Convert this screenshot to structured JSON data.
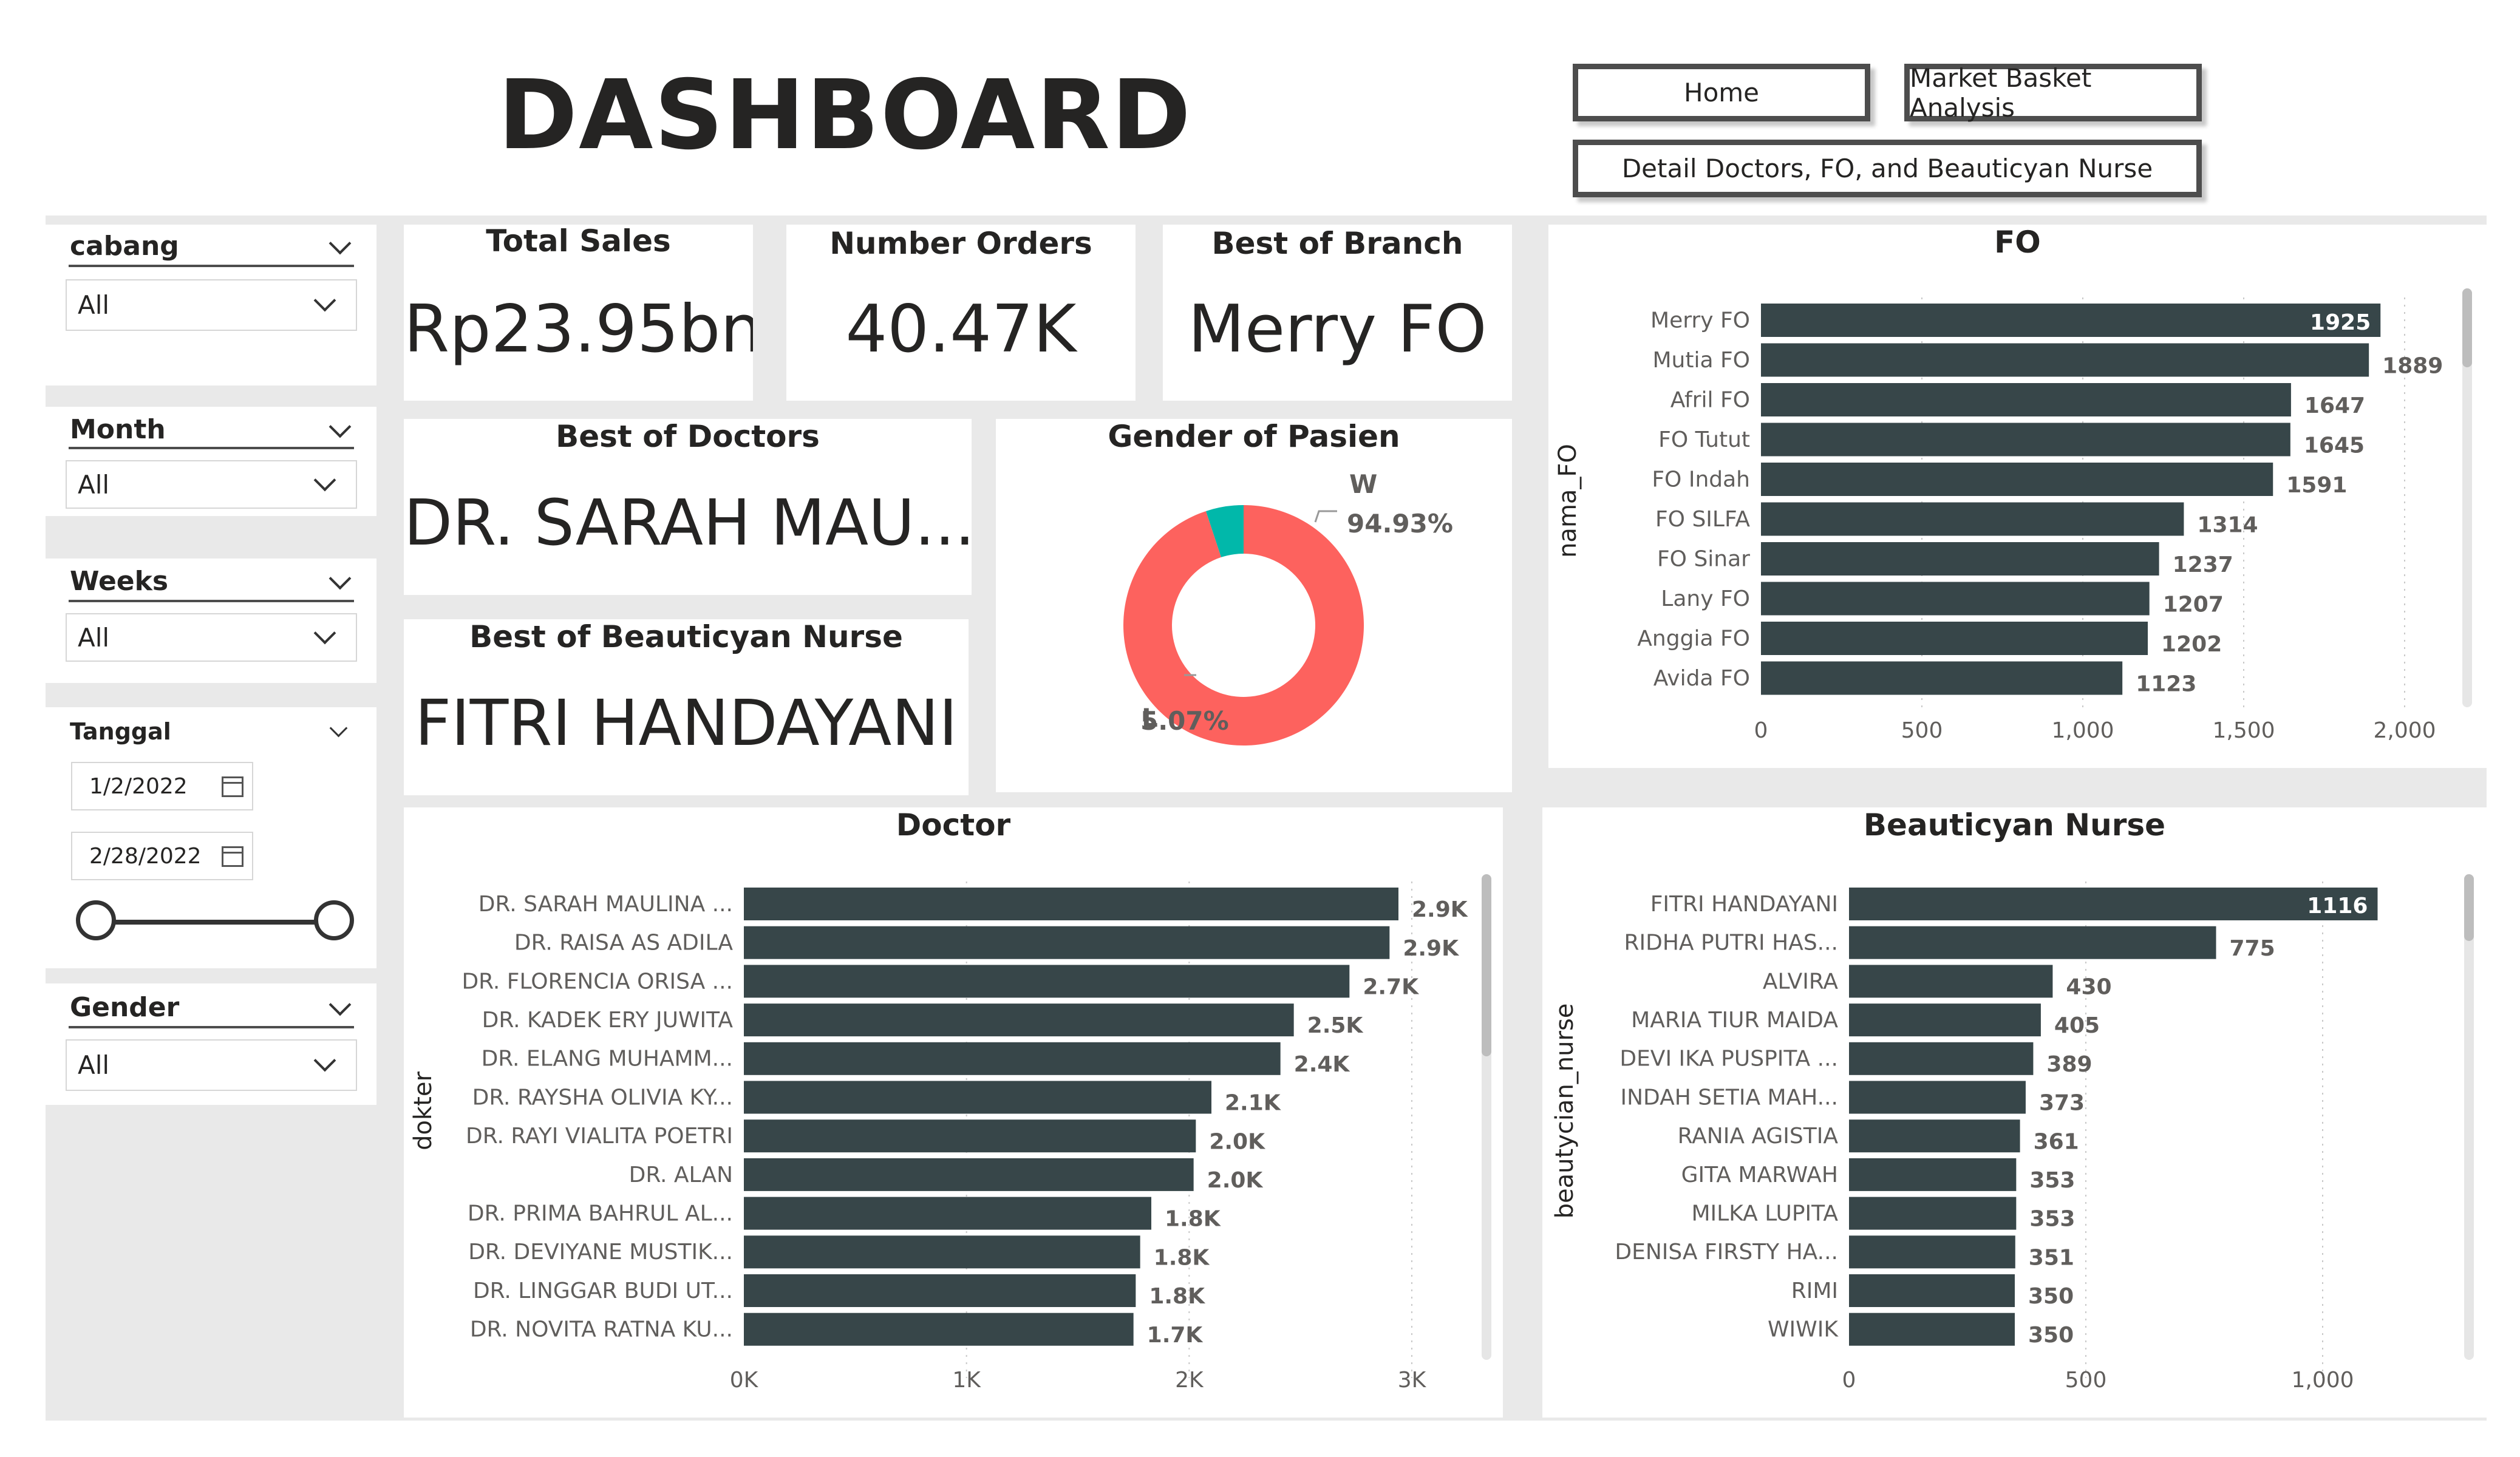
{
  "header": {
    "title": "DASHBOARD",
    "nav": {
      "home": "Home",
      "market_basket": "Market Basket Analysis",
      "detail": "Detail Doctors, FO, and Beauticyan Nurse"
    }
  },
  "filters": {
    "cabang": {
      "label": "cabang",
      "value": "All"
    },
    "month": {
      "label": "Month",
      "value": "All"
    },
    "weeks": {
      "label": "Weeks",
      "value": "All"
    },
    "tanggal": {
      "label": "Tanggal",
      "start": "1/2/2022",
      "end": "2/28/2022"
    },
    "gender": {
      "label": "Gender",
      "value": "All"
    }
  },
  "cards": {
    "total_sales": {
      "title": "Total Sales",
      "value": "Rp23.95bn"
    },
    "number_orders": {
      "title": "Number Orders",
      "value": "40.47K"
    },
    "best_branch": {
      "title": "Best of Branch",
      "value": "Merry FO"
    },
    "best_doctors": {
      "title": "Best of Doctors",
      "value": "DR. SARAH MAU..."
    },
    "best_nurse": {
      "title": "Best of Beauticyan Nurse",
      "value": "FITRI HANDAYANI"
    }
  },
  "colors": {
    "bar": "#374649",
    "donut_w": "#fd625e",
    "donut_l": "#01b8aa",
    "panel_bg": "#e9e9e9"
  },
  "chart_data": [
    {
      "id": "gender",
      "type": "pie",
      "title": "Gender of Pasien",
      "slices": [
        {
          "label": "W",
          "value": 94.93,
          "value_label": "94.93%"
        },
        {
          "label": "L",
          "value": 5.07,
          "value_label": "5.07%"
        }
      ]
    },
    {
      "id": "fo",
      "type": "bar",
      "orientation": "horizontal",
      "title": "FO",
      "ylabel": "nama_FO",
      "categories": [
        "Merry FO",
        "Mutia FO",
        "Afril FO",
        "FO Tutut",
        "FO Indah",
        "FO SILFA",
        "FO Sinar",
        "Lany FO",
        "Anggia FO",
        "Avida FO"
      ],
      "values": [
        1925,
        1889,
        1647,
        1645,
        1591,
        1314,
        1237,
        1207,
        1202,
        1123
      ],
      "data_labels": [
        "1925",
        "1889",
        "1647",
        "1645",
        "1591",
        "1314",
        "1237",
        "1207",
        "1202",
        "1123"
      ],
      "xlim": [
        0,
        2000
      ],
      "ticks": [
        0,
        500,
        1000,
        1500,
        2000
      ],
      "tick_labels": [
        "0",
        "500",
        "1,000",
        "1,500",
        "2,000"
      ]
    },
    {
      "id": "doctor",
      "type": "bar",
      "orientation": "horizontal",
      "title": "Doctor",
      "ylabel": "dokter",
      "categories": [
        "DR. SARAH MAULINA ...",
        "DR. RAISA AS ADILA",
        "DR. FLORENCIA ORISA ...",
        "DR. KADEK ERY JUWITA",
        "DR. ELANG MUHAMM...",
        "DR. RAYSHA OLIVIA KY...",
        "DR. RAYI VIALITA POETRI",
        "DR. ALAN",
        "DR. PRIMA BAHRUL AL...",
        "DR. DEVIYANE MUSTIK...",
        "DR. LINGGAR BUDI UT...",
        "DR. NOVITA RATNA KU..."
      ],
      "values": [
        2940,
        2900,
        2720,
        2470,
        2410,
        2100,
        2030,
        2020,
        1830,
        1780,
        1760,
        1750
      ],
      "data_labels": [
        "2.9K",
        "2.9K",
        "2.7K",
        "2.5K",
        "2.4K",
        "2.1K",
        "2.0K",
        "2.0K",
        "1.8K",
        "1.8K",
        "1.8K",
        "1.7K"
      ],
      "xlim": [
        0,
        3000
      ],
      "ticks": [
        0,
        1000,
        2000,
        3000
      ],
      "tick_labels": [
        "0K",
        "1K",
        "2K",
        "3K"
      ]
    },
    {
      "id": "nurse",
      "type": "bar",
      "orientation": "horizontal",
      "title": "Beauticyan Nurse",
      "ylabel": "beautycian_nurse",
      "categories": [
        "FITRI HANDAYANI",
        "RIDHA PUTRI HAS...",
        "ALVIRA",
        "MARIA TIUR MAIDA",
        "DEVI IKA PUSPITA ...",
        "INDAH SETIA MAH...",
        "RANIA AGISTIA",
        "GITA MARWAH",
        "MILKA LUPITA",
        "DENISA FIRSTY HA...",
        "RIMI",
        "WIWIK"
      ],
      "values": [
        1116,
        775,
        430,
        405,
        389,
        373,
        361,
        353,
        353,
        351,
        350,
        350
      ],
      "data_labels": [
        "1116",
        "775",
        "430",
        "405",
        "389",
        "373",
        "361",
        "353",
        "353",
        "351",
        "350",
        "350"
      ],
      "xlim": [
        0,
        1000
      ],
      "ticks": [
        0,
        500,
        1000
      ],
      "tick_labels": [
        "0",
        "500",
        "1,000"
      ]
    }
  ]
}
